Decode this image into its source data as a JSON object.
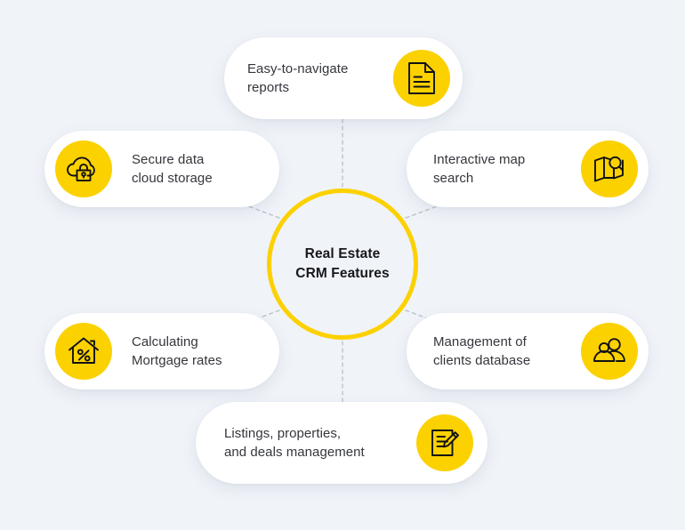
{
  "theme": {
    "background": "#f0f3f8",
    "accent": "#FCD100",
    "card_background": "#ffffff",
    "text_color": "#34363c",
    "hub_text_color": "#17181c",
    "connector_color": "#b9bec9"
  },
  "hub": {
    "label": "Real Estate\nCRM Features"
  },
  "features": [
    {
      "id": "reports",
      "label": "Easy-to-navigate\nreports",
      "icon": "document-icon",
      "icon_position": "right"
    },
    {
      "id": "cloud",
      "label": "Secure data\ncloud storage",
      "icon": "cloud-lock-icon",
      "icon_position": "left"
    },
    {
      "id": "map",
      "label": "Interactive map\nsearch",
      "icon": "map-search-icon",
      "icon_position": "right"
    },
    {
      "id": "mortgage",
      "label": "Calculating\nMortgage rates",
      "icon": "house-percent-icon",
      "icon_position": "left"
    },
    {
      "id": "clients",
      "label": "Management of\nclients database",
      "icon": "users-icon",
      "icon_position": "right"
    },
    {
      "id": "listings",
      "label": "Listings, properties,\nand deals management",
      "icon": "document-edit-icon",
      "icon_position": "right"
    }
  ]
}
